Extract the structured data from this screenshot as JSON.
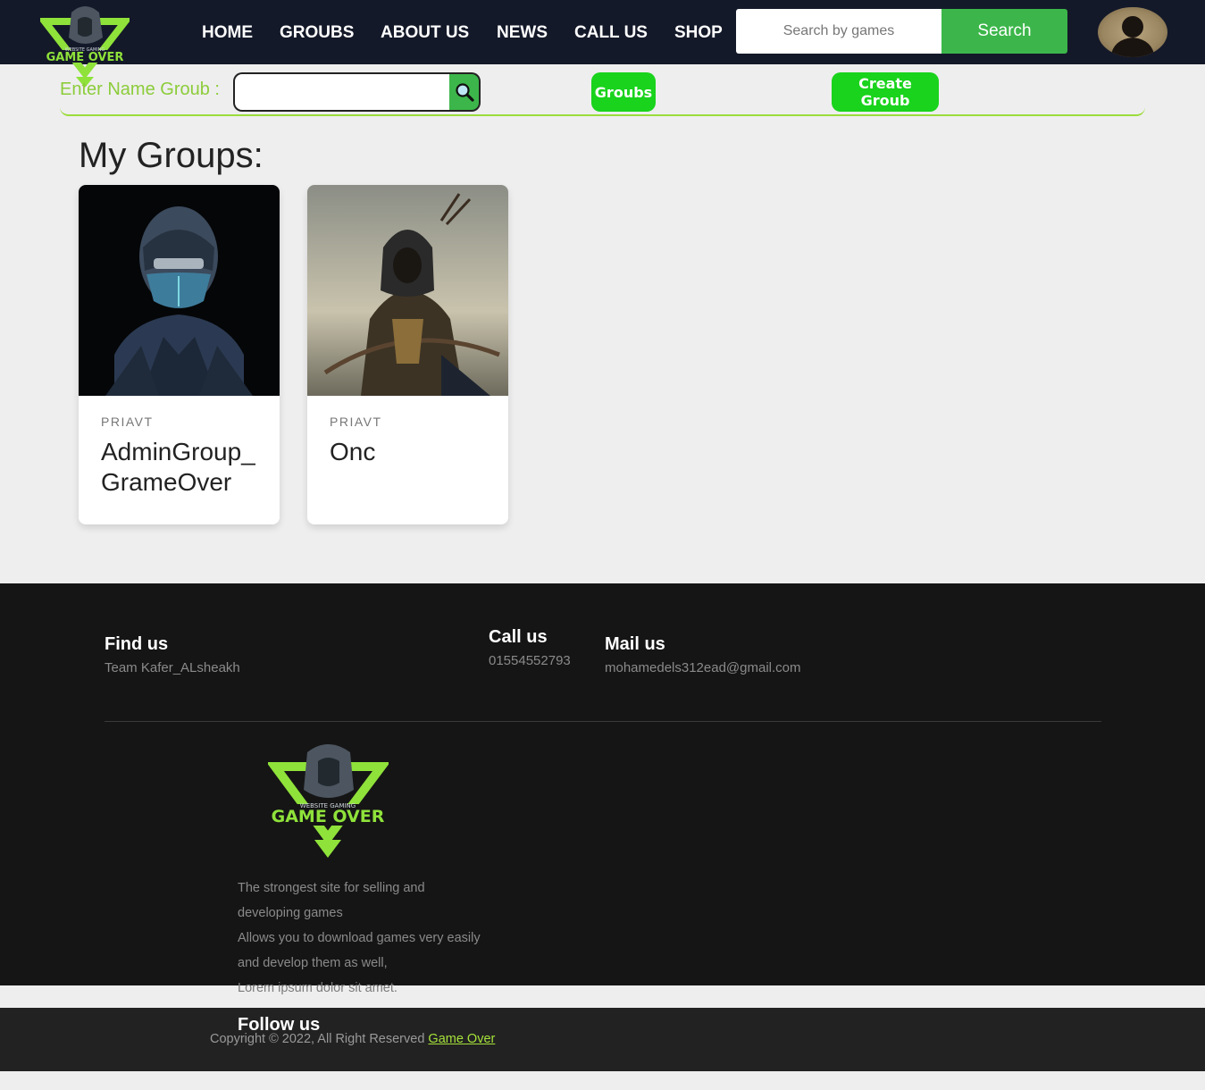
{
  "header": {
    "logo_text": "GAME OVER",
    "logo_subtext": "WEBSITE GAMING",
    "nav": [
      {
        "label": "HOME"
      },
      {
        "label": "GROUBS"
      },
      {
        "label": "ABOUT US"
      },
      {
        "label": "NEWS"
      },
      {
        "label": "CALL US"
      },
      {
        "label": "SHOP"
      }
    ],
    "search_placeholder": "Search by games",
    "search_button": "Search"
  },
  "group_bar": {
    "label": "Enter Name Groub :",
    "input_value": "",
    "groubs_button": "Groubs",
    "create_button": "Create Groub"
  },
  "main": {
    "heading": "My Groups:",
    "cards": [
      {
        "tag": "PRIAVT",
        "title": "AdminGroup_GrameOver"
      },
      {
        "tag": "PRIAVT",
        "title": "Onc"
      }
    ]
  },
  "footer": {
    "find_us": {
      "title": "Find us",
      "text": "Team Kafer_ALsheakh"
    },
    "call_us": {
      "title": "Call us",
      "text": "01554552793"
    },
    "mail_us": {
      "title": "Mail us",
      "text": "mohamedels312ead@gmail.com"
    },
    "description": [
      "The strongest site for selling and",
      "developing games",
      "Allows you to download games very easily",
      "and develop them as well,",
      "Lorem ipsum dolor sit amet."
    ],
    "follow_us": "Follow us",
    "copyright_prefix": "Copyright © 2022, All Right Reserved ",
    "copyright_link": "Game Over"
  },
  "colors": {
    "topbar": "#141929",
    "accent_green": "#3cb64a",
    "pill_green": "#19d31c",
    "lime": "#9adc3a",
    "footer": "#151515"
  }
}
